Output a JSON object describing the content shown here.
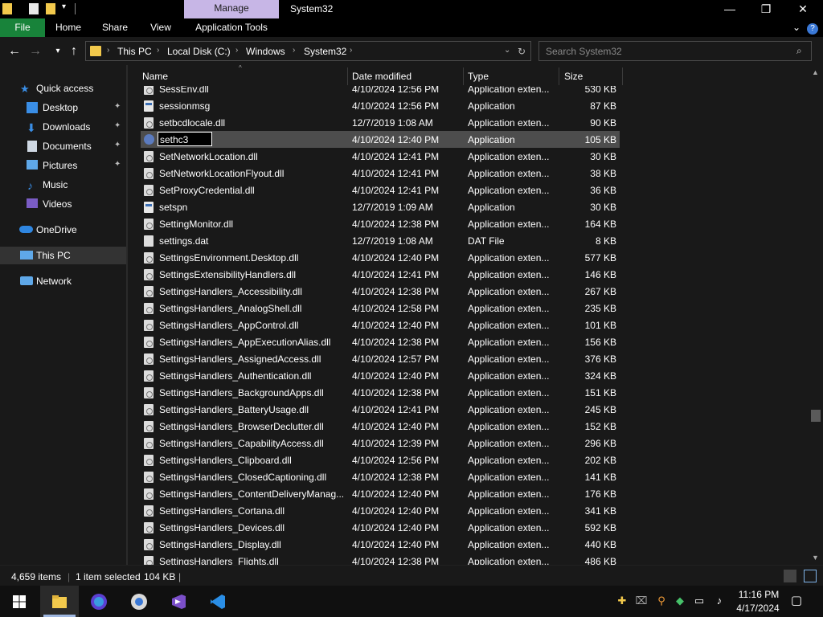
{
  "titlebar": {
    "manage_label": "Manage",
    "window_title": "System32",
    "minimize": "—",
    "maximize": "❐",
    "close": "✕"
  },
  "ribbon": {
    "tabs": [
      "File",
      "Home",
      "Share",
      "View",
      "Application Tools"
    ],
    "help": "?",
    "expand": "⌄"
  },
  "address": {
    "crumbs": [
      "This PC",
      "Local Disk (C:)",
      "Windows",
      "System32"
    ],
    "search_placeholder": "Search System32"
  },
  "nav": {
    "items": [
      {
        "label": "Quick access",
        "icon": "star-icon"
      },
      {
        "label": "Desktop",
        "icon": "desktop-icon",
        "pinned": true
      },
      {
        "label": "Downloads",
        "icon": "download-icon",
        "pinned": true
      },
      {
        "label": "Documents",
        "icon": "documents-icon",
        "pinned": true
      },
      {
        "label": "Pictures",
        "icon": "pictures-icon",
        "pinned": true
      },
      {
        "label": "Music",
        "icon": "music-icon"
      },
      {
        "label": "Videos",
        "icon": "videos-icon"
      },
      {
        "label": "OneDrive",
        "icon": "cloud-icon"
      },
      {
        "label": "This PC",
        "icon": "computer-icon"
      },
      {
        "label": "Network",
        "icon": "network-icon"
      }
    ]
  },
  "columns": {
    "name": "Name",
    "date": "Date modified",
    "type": "Type",
    "size": "Size"
  },
  "files": [
    {
      "name": "SessEnv.dll",
      "date": "4/10/2024 12:56 PM",
      "type": "Application exten...",
      "size": "530 KB",
      "kind": "dll"
    },
    {
      "name": "sessionmsg",
      "date": "4/10/2024 12:56 PM",
      "type": "Application",
      "size": "87 KB",
      "kind": "app"
    },
    {
      "name": "setbcdlocale.dll",
      "date": "12/7/2019 1:08 AM",
      "type": "Application exten...",
      "size": "90 KB",
      "kind": "dll"
    },
    {
      "name": "sethc3",
      "date": "4/10/2024 12:40 PM",
      "type": "Application",
      "size": "105 KB",
      "kind": "sethc"
    },
    {
      "name": "SetNetworkLocation.dll",
      "date": "4/10/2024 12:41 PM",
      "type": "Application exten...",
      "size": "30 KB",
      "kind": "dll"
    },
    {
      "name": "SetNetworkLocationFlyout.dll",
      "date": "4/10/2024 12:41 PM",
      "type": "Application exten...",
      "size": "38 KB",
      "kind": "dll"
    },
    {
      "name": "SetProxyCredential.dll",
      "date": "4/10/2024 12:41 PM",
      "type": "Application exten...",
      "size": "36 KB",
      "kind": "dll"
    },
    {
      "name": "setspn",
      "date": "12/7/2019 1:09 AM",
      "type": "Application",
      "size": "30 KB",
      "kind": "app"
    },
    {
      "name": "SettingMonitor.dll",
      "date": "4/10/2024 12:38 PM",
      "type": "Application exten...",
      "size": "164 KB",
      "kind": "dll"
    },
    {
      "name": "settings.dat",
      "date": "12/7/2019 1:08 AM",
      "type": "DAT File",
      "size": "8 KB",
      "kind": "file"
    },
    {
      "name": "SettingsEnvironment.Desktop.dll",
      "date": "4/10/2024 12:40 PM",
      "type": "Application exten...",
      "size": "577 KB",
      "kind": "dll"
    },
    {
      "name": "SettingsExtensibilityHandlers.dll",
      "date": "4/10/2024 12:41 PM",
      "type": "Application exten...",
      "size": "146 KB",
      "kind": "dll"
    },
    {
      "name": "SettingsHandlers_Accessibility.dll",
      "date": "4/10/2024 12:38 PM",
      "type": "Application exten...",
      "size": "267 KB",
      "kind": "dll"
    },
    {
      "name": "SettingsHandlers_AnalogShell.dll",
      "date": "4/10/2024 12:58 PM",
      "type": "Application exten...",
      "size": "235 KB",
      "kind": "dll"
    },
    {
      "name": "SettingsHandlers_AppControl.dll",
      "date": "4/10/2024 12:40 PM",
      "type": "Application exten...",
      "size": "101 KB",
      "kind": "dll"
    },
    {
      "name": "SettingsHandlers_AppExecutionAlias.dll",
      "date": "4/10/2024 12:38 PM",
      "type": "Application exten...",
      "size": "156 KB",
      "kind": "dll"
    },
    {
      "name": "SettingsHandlers_AssignedAccess.dll",
      "date": "4/10/2024 12:57 PM",
      "type": "Application exten...",
      "size": "376 KB",
      "kind": "dll"
    },
    {
      "name": "SettingsHandlers_Authentication.dll",
      "date": "4/10/2024 12:40 PM",
      "type": "Application exten...",
      "size": "324 KB",
      "kind": "dll"
    },
    {
      "name": "SettingsHandlers_BackgroundApps.dll",
      "date": "4/10/2024 12:38 PM",
      "type": "Application exten...",
      "size": "151 KB",
      "kind": "dll"
    },
    {
      "name": "SettingsHandlers_BatteryUsage.dll",
      "date": "4/10/2024 12:41 PM",
      "type": "Application exten...",
      "size": "245 KB",
      "kind": "dll"
    },
    {
      "name": "SettingsHandlers_BrowserDeclutter.dll",
      "date": "4/10/2024 12:40 PM",
      "type": "Application exten...",
      "size": "152 KB",
      "kind": "dll"
    },
    {
      "name": "SettingsHandlers_CapabilityAccess.dll",
      "date": "4/10/2024 12:39 PM",
      "type": "Application exten...",
      "size": "296 KB",
      "kind": "dll"
    },
    {
      "name": "SettingsHandlers_Clipboard.dll",
      "date": "4/10/2024 12:56 PM",
      "type": "Application exten...",
      "size": "202 KB",
      "kind": "dll"
    },
    {
      "name": "SettingsHandlers_ClosedCaptioning.dll",
      "date": "4/10/2024 12:38 PM",
      "type": "Application exten...",
      "size": "141 KB",
      "kind": "dll"
    },
    {
      "name": "SettingsHandlers_ContentDeliveryManag...",
      "date": "4/10/2024 12:40 PM",
      "type": "Application exten...",
      "size": "176 KB",
      "kind": "dll"
    },
    {
      "name": "SettingsHandlers_Cortana.dll",
      "date": "4/10/2024 12:40 PM",
      "type": "Application exten...",
      "size": "341 KB",
      "kind": "dll"
    },
    {
      "name": "SettingsHandlers_Devices.dll",
      "date": "4/10/2024 12:40 PM",
      "type": "Application exten...",
      "size": "592 KB",
      "kind": "dll"
    },
    {
      "name": "SettingsHandlers_Display.dll",
      "date": "4/10/2024 12:40 PM",
      "type": "Application exten...",
      "size": "440 KB",
      "kind": "dll"
    },
    {
      "name": "SettingsHandlers_Flights.dll",
      "date": "4/10/2024 12:38 PM",
      "type": "Application exten...",
      "size": "486 KB",
      "kind": "dll"
    }
  ],
  "selected_index": 3,
  "rename_text": "sethc3",
  "status": {
    "count": "4,659 items",
    "selection": "1 item selected",
    "size": "104 KB"
  },
  "taskbar": {
    "time": "11:16 PM",
    "date": "4/17/2024"
  },
  "colors": {
    "file_tab": "#18833a",
    "manage_tab": "#c7b6e6",
    "selected_row": "#4d4d4d"
  }
}
